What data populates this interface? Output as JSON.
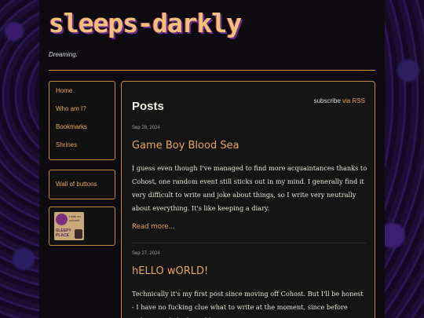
{
  "site": {
    "logo": "sleeps-darkly",
    "tagline": "Dreaming."
  },
  "nav": {
    "items": [
      {
        "label": "Home"
      },
      {
        "label": "Who am I?"
      },
      {
        "label": "Bookmarks"
      },
      {
        "label": "Shrines"
      }
    ],
    "wall_label": "Wall of buttons"
  },
  "badge": {
    "top_text": "i was on cohost!",
    "bottom_text": "SLEEPY PLACE"
  },
  "main": {
    "title": "Posts",
    "subscribe_prefix": "subscribe",
    "subscribe_link": "via RSS"
  },
  "posts": [
    {
      "date": "Sep 28, 2024",
      "title": "Game Boy Blood Sea",
      "body": "I guess even though I've managed to find more acquaintances thanks to Cohost, one random event still sticks out in my mind. I generally find it very difficult to write and joke about things, so I write very neutrally about everything. It's like keeping a diary.",
      "read_more": "Read more..."
    },
    {
      "date": "Sep 27, 2024",
      "title": "hELLO wORLD!",
      "body": "Technically it's my first post since moving off Cohost. But I'll be honest - I have no fucking clue what to write at the moment, since before Cohost I only had an old"
    }
  ],
  "colors": {
    "accent": "#e9a55b",
    "border": "#c6853f",
    "panel": "#151515"
  }
}
